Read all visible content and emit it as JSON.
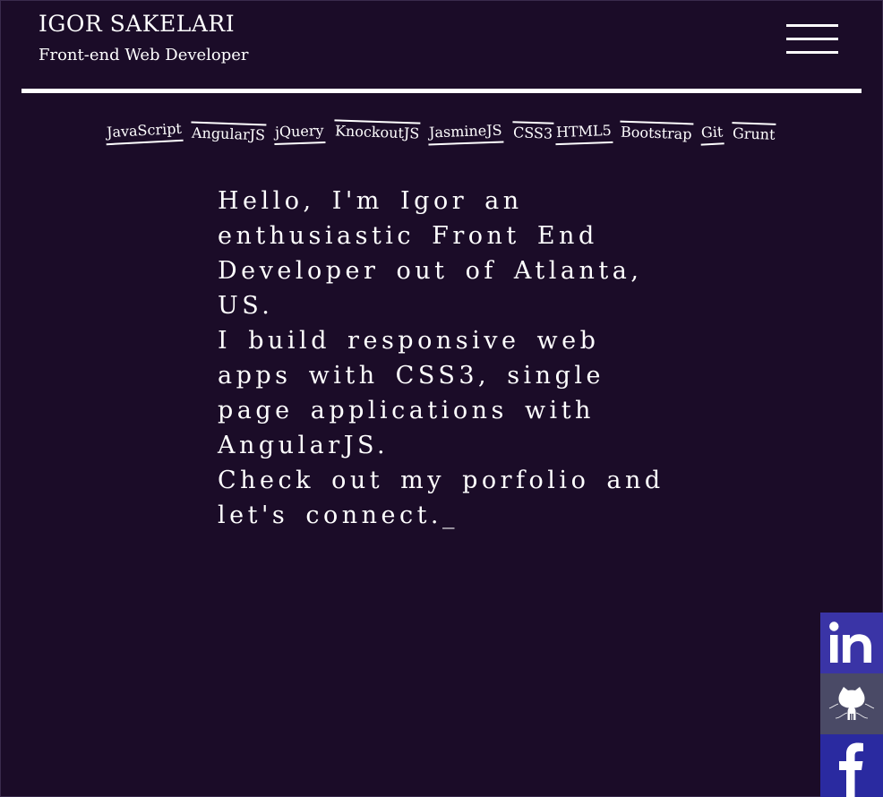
{
  "header": {
    "name": "IGOR SAKELARI",
    "subtitle": "Front-end Web Developer"
  },
  "skills": [
    "JavaScript",
    "AngularJS",
    "jQuery",
    "KnockoutJS",
    "JasmineJS",
    "CSS3",
    "HTML5",
    "Bootstrap",
    "Git",
    "Grunt"
  ],
  "intro": {
    "line1": "Hello, I'm Igor an enthusiastic Front End Developer out of Atlanta, US.",
    "line2": "I build responsive web apps with CSS3, single page applications with AngularJS.",
    "line3": "Check out my porfolio and let's connect._"
  },
  "social": [
    {
      "icon": "linkedin-icon",
      "color": "#3a34a6"
    },
    {
      "icon": "github-icon",
      "color": "#4a4a66"
    },
    {
      "icon": "facebook-icon",
      "color": "#2a2aa0"
    }
  ],
  "colors": {
    "background": "#1b0c28",
    "text": "#ffffff"
  }
}
